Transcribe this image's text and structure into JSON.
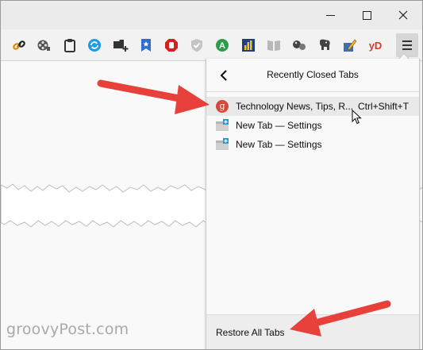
{
  "window": {
    "controls": {
      "minimize": "minimize-icon",
      "maximize": "maximize-icon",
      "close": "close-icon"
    }
  },
  "toolbar": {
    "extensions": [
      {
        "icon": "link-icon",
        "color": "#e08a00"
      },
      {
        "icon": "film-reel-icon",
        "color": "#555555"
      },
      {
        "icon": "clipboard-icon",
        "color": "#333333"
      },
      {
        "icon": "sync-icon",
        "color": "#1a9be6"
      },
      {
        "icon": "add-tab-icon",
        "color": "#333333"
      },
      {
        "icon": "bookmark-star-icon",
        "color": "#2f6fd0"
      },
      {
        "icon": "stop-hand-icon",
        "color": "#d32020"
      },
      {
        "icon": "shield-icon",
        "color": "#9a9a9a"
      },
      {
        "icon": "circle-a-icon",
        "color": "#2e9d4a"
      },
      {
        "icon": "bar-chart-icon",
        "color": "#2a5ca8"
      },
      {
        "icon": "book-icon",
        "color": "#9a9a9a"
      },
      {
        "icon": "bubbles-icon",
        "color": "#444444"
      },
      {
        "icon": "elephant-icon",
        "color": "#444444"
      },
      {
        "icon": "pencil-box-icon",
        "color": "#3a6fb0"
      },
      {
        "icon": "yd-icon",
        "label": "yD",
        "color": "#d63a2a"
      }
    ],
    "menu_icon": "hamburger-menu-icon"
  },
  "panel": {
    "title": "Recently Closed Tabs",
    "back_icon": "chevron-left-icon",
    "items": [
      {
        "label": "Technology News, Tips, R...",
        "shortcut": "Ctrl+Shift+T",
        "icon": "groovypost-favicon-icon",
        "favicon_letter": "g"
      },
      {
        "label": "New Tab — Settings",
        "icon": "new-tab-page-icon"
      },
      {
        "label": "New Tab — Settings",
        "icon": "new-tab-page-icon"
      }
    ],
    "restore_all_label": "Restore All Tabs"
  },
  "watermark": "groovyPost.com",
  "colors": {
    "accent_arrow": "#e8413b",
    "panel_bg": "#f9f9fa",
    "hover_bg": "#e9e9ea"
  }
}
